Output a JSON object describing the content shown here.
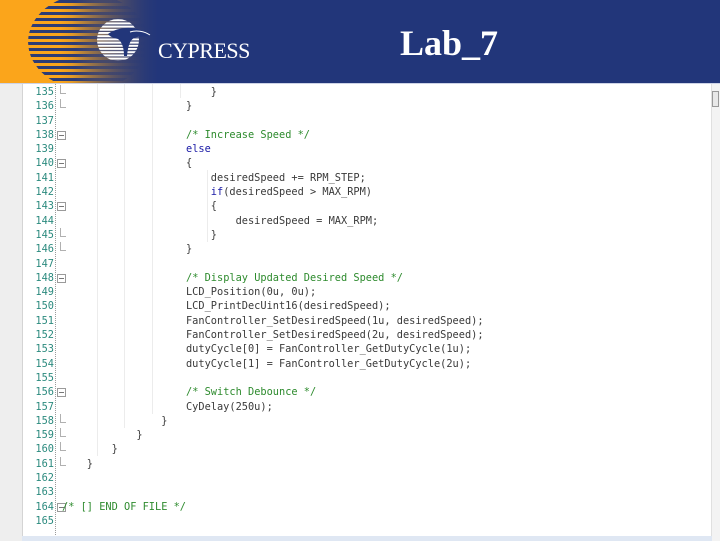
{
  "header": {
    "brand": "CYPRESS",
    "title": "Lab_7",
    "colors": {
      "navy": "#22367a",
      "orange": "#fba51b",
      "title_text": "#ffffff"
    }
  },
  "editor": {
    "colors": {
      "line_number": "#2b8a7e",
      "comment": "#2e8b2e",
      "keyword": "#1a1aa6",
      "text": "#3a3a3a"
    },
    "lines": [
      {
        "n": "135",
        "fold": "end",
        "text": "                        }"
      },
      {
        "n": "136",
        "fold": "end",
        "text": "                    }"
      },
      {
        "n": "137",
        "fold": "",
        "text": ""
      },
      {
        "n": "138",
        "fold": "open",
        "text": "                    ",
        "comment": "/* Increase Speed */"
      },
      {
        "n": "139",
        "fold": "",
        "text": "                    ",
        "keyword": "else"
      },
      {
        "n": "140",
        "fold": "open",
        "text": "                    {"
      },
      {
        "n": "141",
        "fold": "",
        "text": "                        desiredSpeed += RPM_STEP;"
      },
      {
        "n": "142",
        "fold": "",
        "text": "                        ",
        "keyword": "if",
        "rest": "(desiredSpeed > MAX_RPM)"
      },
      {
        "n": "143",
        "fold": "open",
        "text": "                        {"
      },
      {
        "n": "144",
        "fold": "",
        "text": "                            desiredSpeed = MAX_RPM;"
      },
      {
        "n": "145",
        "fold": "end",
        "text": "                        }"
      },
      {
        "n": "146",
        "fold": "end",
        "text": "                    }"
      },
      {
        "n": "147",
        "fold": "",
        "text": ""
      },
      {
        "n": "148",
        "fold": "open",
        "text": "                    ",
        "comment": "/* Display Updated Desired Speed */"
      },
      {
        "n": "149",
        "fold": "",
        "text": "                    LCD_Position(0u, 0u);"
      },
      {
        "n": "150",
        "fold": "",
        "text": "                    LCD_PrintDecUint16(desiredSpeed);"
      },
      {
        "n": "151",
        "fold": "",
        "text": "                    FanController_SetDesiredSpeed(1u, desiredSpeed);"
      },
      {
        "n": "152",
        "fold": "",
        "text": "                    FanController_SetDesiredSpeed(2u, desiredSpeed);"
      },
      {
        "n": "153",
        "fold": "",
        "text": "                    dutyCycle[0] = FanController_GetDutyCycle(1u);"
      },
      {
        "n": "154",
        "fold": "",
        "text": "                    dutyCycle[1] = FanController_GetDutyCycle(2u);"
      },
      {
        "n": "155",
        "fold": "",
        "text": ""
      },
      {
        "n": "156",
        "fold": "open",
        "text": "                    ",
        "comment": "/* Switch Debounce */"
      },
      {
        "n": "157",
        "fold": "",
        "text": "                    CyDelay(250u);"
      },
      {
        "n": "158",
        "fold": "end",
        "text": "                }"
      },
      {
        "n": "159",
        "fold": "end",
        "text": "            }"
      },
      {
        "n": "160",
        "fold": "end",
        "text": "        }"
      },
      {
        "n": "161",
        "fold": "end",
        "text": "    }"
      },
      {
        "n": "162",
        "fold": "",
        "text": ""
      },
      {
        "n": "163",
        "fold": "",
        "text": ""
      },
      {
        "n": "164",
        "fold": "open",
        "text": "",
        "comment": "/* [] END OF FILE */"
      },
      {
        "n": "165",
        "fold": "",
        "text": ""
      }
    ]
  }
}
